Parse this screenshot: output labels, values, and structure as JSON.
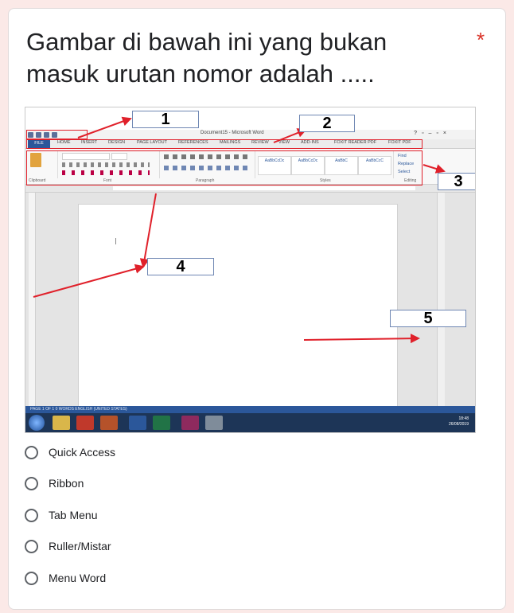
{
  "question": {
    "title": "Gambar di bawah ini yang bukan masuk urutan nomor adalah .....",
    "required_mark": "*"
  },
  "figure": {
    "callouts": [
      "1",
      "2",
      "3",
      "4",
      "5"
    ],
    "word_window": {
      "title": "Document15 - Microsoft Word",
      "tabs": [
        "FILE",
        "HOME",
        "INSERT",
        "DESIGN",
        "PAGE LAYOUT",
        "REFERENCES",
        "MAILINGS",
        "REVIEW",
        "VIEW",
        "ADD-INS",
        "FOXIT READER PDF",
        "FOXIT PDF"
      ],
      "groups": [
        "Clipboard",
        "Font",
        "Paragraph",
        "Styles",
        "Editing"
      ],
      "styles": [
        "AaBbCcDc",
        "AaBbCcDc",
        "AaBbC",
        "AaBbCcC"
      ],
      "editing": [
        "Find",
        "Replace",
        "Select"
      ],
      "status_text": "PAGE 1 OF 1    0 WORDS    ENGLISH (UNITED STATES)",
      "clock_time": "18:48",
      "clock_date": "26/08/2019"
    },
    "colors": {
      "annotation_red": "#e0202a",
      "word_blue": "#2b579a"
    }
  },
  "options": [
    {
      "label": "Quick Access"
    },
    {
      "label": "Ribbon"
    },
    {
      "label": "Tab Menu"
    },
    {
      "label": "Ruller/Mistar"
    },
    {
      "label": "Menu Word"
    }
  ]
}
